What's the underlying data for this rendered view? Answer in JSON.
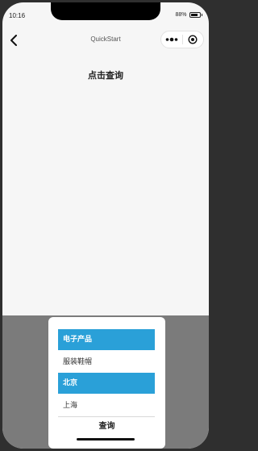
{
  "status_bar": {
    "time": "10:16",
    "battery_text": "88%",
    "battery_level": 0.88
  },
  "nav": {
    "title": "QuickStart"
  },
  "main": {
    "title": "点击查询"
  },
  "picker": {
    "items": [
      {
        "label": "电子产品",
        "selected": true
      },
      {
        "label": "服装鞋帽",
        "selected": false
      },
      {
        "label": "北京",
        "selected": true
      },
      {
        "label": "上海",
        "selected": false
      }
    ],
    "button_label": "查询"
  },
  "colors": {
    "selected_bg": "#2aa0d8",
    "overlay": "#7b7b7b",
    "page_bg": "#f6f6f6"
  }
}
